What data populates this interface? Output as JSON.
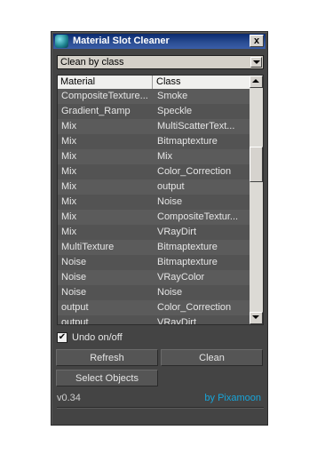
{
  "window": {
    "title": "Material Slot Cleaner",
    "close_label": "x"
  },
  "mode_dropdown": {
    "value": "Clean by class"
  },
  "table": {
    "columns": [
      "Material",
      "Class"
    ],
    "rows": [
      [
        "CompositeTexture...",
        "Smoke"
      ],
      [
        "Gradient_Ramp",
        "Speckle"
      ],
      [
        "Mix",
        "MultiScatterText..."
      ],
      [
        "Mix",
        "Bitmaptexture"
      ],
      [
        "Mix",
        "Mix"
      ],
      [
        "Mix",
        "Color_Correction"
      ],
      [
        "Mix",
        "output"
      ],
      [
        "Mix",
        "Noise"
      ],
      [
        "Mix",
        "CompositeTextur..."
      ],
      [
        "Mix",
        "VRayDirt"
      ],
      [
        "MultiTexture",
        "Bitmaptexture"
      ],
      [
        "Noise",
        "Bitmaptexture"
      ],
      [
        "Noise",
        "VRayColor"
      ],
      [
        "Noise",
        "Noise"
      ],
      [
        "output",
        "Color_Correction"
      ],
      [
        "output",
        "VRayDirt"
      ]
    ]
  },
  "undo": {
    "label": "Undo on/off",
    "checked": true,
    "check_glyph": "✔"
  },
  "buttons": {
    "refresh": "Refresh",
    "clean": "Clean",
    "select_objects": "Select Objects"
  },
  "footer": {
    "version": "v0.34",
    "credit": "by Pixamoon",
    "credit_color": "#18a4d8"
  },
  "icons": [
    "app-icon",
    "close-icon",
    "chevron-down-icon",
    "scroll-up-icon",
    "scroll-down-icon",
    "checkmark-icon"
  ]
}
